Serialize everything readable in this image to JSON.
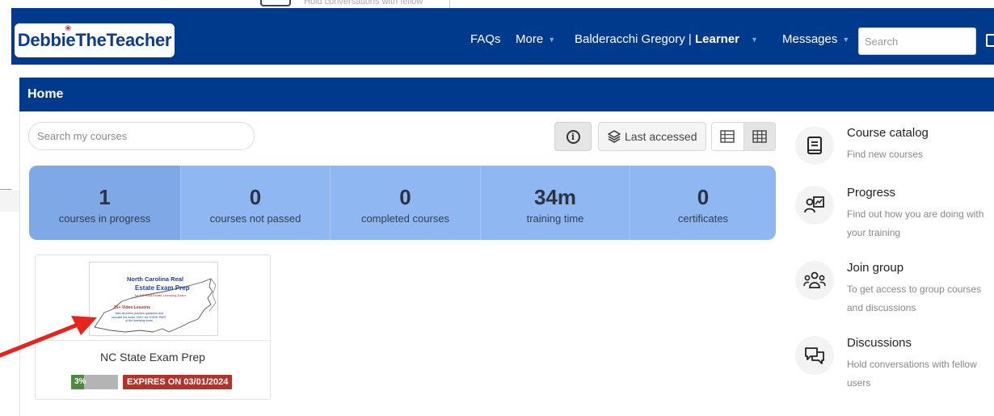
{
  "behind_window": {
    "text": "Hold conversations with fellow"
  },
  "navbar": {
    "logo_text": "DebbieTheTeacher",
    "faqs_label": "FAQs",
    "more_label": "More",
    "user_name": "Balderacchi Gregory | ",
    "user_role": "Learner",
    "messages_label": "Messages",
    "search_placeholder": "Search",
    "brand_color": "#003a8c"
  },
  "home": {
    "title": "Home"
  },
  "toolbar": {
    "search_placeholder": "Search my courses",
    "info_icon_glyph": "i",
    "sort_label": "Last accessed"
  },
  "stats": [
    {
      "value": "1",
      "label": "courses in progress"
    },
    {
      "value": "0",
      "label": "courses not passed"
    },
    {
      "value": "0",
      "label": "completed courses"
    },
    {
      "value": "34m",
      "label": "training time"
    },
    {
      "value": "0",
      "label": "certificates"
    }
  ],
  "course": {
    "thumb_line1": "North Carolina Real",
    "thumb_line2": "Estate Exam Prep",
    "thumb_line3": "for NC Real Estate Licensing Exam",
    "thumb_line4": "15+ Video Lessons",
    "thumb_line5": "Take all prelim practice questions and simulate the exam ONLY the STATE PART of the licensing exam",
    "title": "NC State Exam Prep",
    "progress_percent": 3,
    "progress_label": "3%",
    "expires_label": "EXPIRES ON 03/01/2024",
    "progress_color": "#4c8a3c",
    "expires_color": "#b0342c"
  },
  "side_panel": [
    {
      "icon": "book-icon",
      "title": "Course catalog",
      "desc": "Find new courses"
    },
    {
      "icon": "progress-chart-icon",
      "title": "Progress",
      "desc": "Find out how you are doing with your training"
    },
    {
      "icon": "group-icon",
      "title": "Join group",
      "desc": "To get access to group courses and discussions"
    },
    {
      "icon": "chat-icon",
      "title": "Discussions",
      "desc": "Hold conversations with fellow users"
    }
  ],
  "annotation": {
    "arrow_color": "#e8231c"
  }
}
